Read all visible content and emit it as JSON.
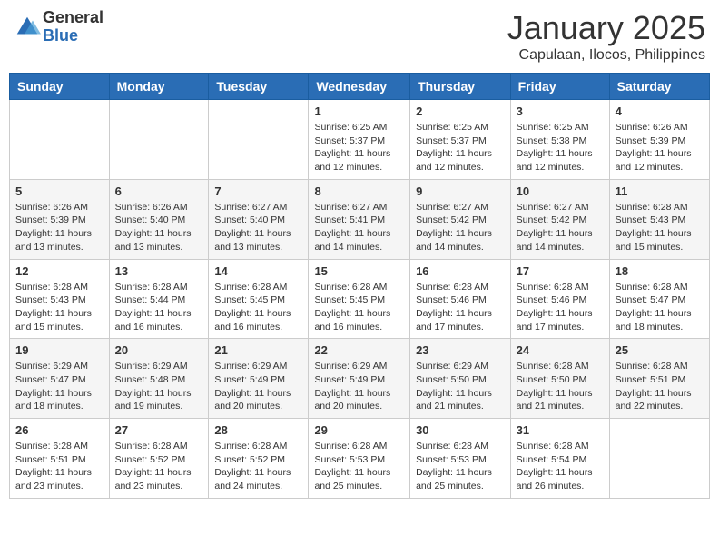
{
  "logo": {
    "general": "General",
    "blue": "Blue"
  },
  "header": {
    "month": "January 2025",
    "location": "Capulaan, Ilocos, Philippines"
  },
  "weekdays": [
    "Sunday",
    "Monday",
    "Tuesday",
    "Wednesday",
    "Thursday",
    "Friday",
    "Saturday"
  ],
  "weeks": [
    [
      {
        "day": "",
        "sunrise": "",
        "sunset": "",
        "daylight": ""
      },
      {
        "day": "",
        "sunrise": "",
        "sunset": "",
        "daylight": ""
      },
      {
        "day": "",
        "sunrise": "",
        "sunset": "",
        "daylight": ""
      },
      {
        "day": "1",
        "sunrise": "Sunrise: 6:25 AM",
        "sunset": "Sunset: 5:37 PM",
        "daylight": "Daylight: 11 hours and 12 minutes."
      },
      {
        "day": "2",
        "sunrise": "Sunrise: 6:25 AM",
        "sunset": "Sunset: 5:37 PM",
        "daylight": "Daylight: 11 hours and 12 minutes."
      },
      {
        "day": "3",
        "sunrise": "Sunrise: 6:25 AM",
        "sunset": "Sunset: 5:38 PM",
        "daylight": "Daylight: 11 hours and 12 minutes."
      },
      {
        "day": "4",
        "sunrise": "Sunrise: 6:26 AM",
        "sunset": "Sunset: 5:39 PM",
        "daylight": "Daylight: 11 hours and 12 minutes."
      }
    ],
    [
      {
        "day": "5",
        "sunrise": "Sunrise: 6:26 AM",
        "sunset": "Sunset: 5:39 PM",
        "daylight": "Daylight: 11 hours and 13 minutes."
      },
      {
        "day": "6",
        "sunrise": "Sunrise: 6:26 AM",
        "sunset": "Sunset: 5:40 PM",
        "daylight": "Daylight: 11 hours and 13 minutes."
      },
      {
        "day": "7",
        "sunrise": "Sunrise: 6:27 AM",
        "sunset": "Sunset: 5:40 PM",
        "daylight": "Daylight: 11 hours and 13 minutes."
      },
      {
        "day": "8",
        "sunrise": "Sunrise: 6:27 AM",
        "sunset": "Sunset: 5:41 PM",
        "daylight": "Daylight: 11 hours and 14 minutes."
      },
      {
        "day": "9",
        "sunrise": "Sunrise: 6:27 AM",
        "sunset": "Sunset: 5:42 PM",
        "daylight": "Daylight: 11 hours and 14 minutes."
      },
      {
        "day": "10",
        "sunrise": "Sunrise: 6:27 AM",
        "sunset": "Sunset: 5:42 PM",
        "daylight": "Daylight: 11 hours and 14 minutes."
      },
      {
        "day": "11",
        "sunrise": "Sunrise: 6:28 AM",
        "sunset": "Sunset: 5:43 PM",
        "daylight": "Daylight: 11 hours and 15 minutes."
      }
    ],
    [
      {
        "day": "12",
        "sunrise": "Sunrise: 6:28 AM",
        "sunset": "Sunset: 5:43 PM",
        "daylight": "Daylight: 11 hours and 15 minutes."
      },
      {
        "day": "13",
        "sunrise": "Sunrise: 6:28 AM",
        "sunset": "Sunset: 5:44 PM",
        "daylight": "Daylight: 11 hours and 16 minutes."
      },
      {
        "day": "14",
        "sunrise": "Sunrise: 6:28 AM",
        "sunset": "Sunset: 5:45 PM",
        "daylight": "Daylight: 11 hours and 16 minutes."
      },
      {
        "day": "15",
        "sunrise": "Sunrise: 6:28 AM",
        "sunset": "Sunset: 5:45 PM",
        "daylight": "Daylight: 11 hours and 16 minutes."
      },
      {
        "day": "16",
        "sunrise": "Sunrise: 6:28 AM",
        "sunset": "Sunset: 5:46 PM",
        "daylight": "Daylight: 11 hours and 17 minutes."
      },
      {
        "day": "17",
        "sunrise": "Sunrise: 6:28 AM",
        "sunset": "Sunset: 5:46 PM",
        "daylight": "Daylight: 11 hours and 17 minutes."
      },
      {
        "day": "18",
        "sunrise": "Sunrise: 6:28 AM",
        "sunset": "Sunset: 5:47 PM",
        "daylight": "Daylight: 11 hours and 18 minutes."
      }
    ],
    [
      {
        "day": "19",
        "sunrise": "Sunrise: 6:29 AM",
        "sunset": "Sunset: 5:47 PM",
        "daylight": "Daylight: 11 hours and 18 minutes."
      },
      {
        "day": "20",
        "sunrise": "Sunrise: 6:29 AM",
        "sunset": "Sunset: 5:48 PM",
        "daylight": "Daylight: 11 hours and 19 minutes."
      },
      {
        "day": "21",
        "sunrise": "Sunrise: 6:29 AM",
        "sunset": "Sunset: 5:49 PM",
        "daylight": "Daylight: 11 hours and 20 minutes."
      },
      {
        "day": "22",
        "sunrise": "Sunrise: 6:29 AM",
        "sunset": "Sunset: 5:49 PM",
        "daylight": "Daylight: 11 hours and 20 minutes."
      },
      {
        "day": "23",
        "sunrise": "Sunrise: 6:29 AM",
        "sunset": "Sunset: 5:50 PM",
        "daylight": "Daylight: 11 hours and 21 minutes."
      },
      {
        "day": "24",
        "sunrise": "Sunrise: 6:28 AM",
        "sunset": "Sunset: 5:50 PM",
        "daylight": "Daylight: 11 hours and 21 minutes."
      },
      {
        "day": "25",
        "sunrise": "Sunrise: 6:28 AM",
        "sunset": "Sunset: 5:51 PM",
        "daylight": "Daylight: 11 hours and 22 minutes."
      }
    ],
    [
      {
        "day": "26",
        "sunrise": "Sunrise: 6:28 AM",
        "sunset": "Sunset: 5:51 PM",
        "daylight": "Daylight: 11 hours and 23 minutes."
      },
      {
        "day": "27",
        "sunrise": "Sunrise: 6:28 AM",
        "sunset": "Sunset: 5:52 PM",
        "daylight": "Daylight: 11 hours and 23 minutes."
      },
      {
        "day": "28",
        "sunrise": "Sunrise: 6:28 AM",
        "sunset": "Sunset: 5:52 PM",
        "daylight": "Daylight: 11 hours and 24 minutes."
      },
      {
        "day": "29",
        "sunrise": "Sunrise: 6:28 AM",
        "sunset": "Sunset: 5:53 PM",
        "daylight": "Daylight: 11 hours and 25 minutes."
      },
      {
        "day": "30",
        "sunrise": "Sunrise: 6:28 AM",
        "sunset": "Sunset: 5:53 PM",
        "daylight": "Daylight: 11 hours and 25 minutes."
      },
      {
        "day": "31",
        "sunrise": "Sunrise: 6:28 AM",
        "sunset": "Sunset: 5:54 PM",
        "daylight": "Daylight: 11 hours and 26 minutes."
      },
      {
        "day": "",
        "sunrise": "",
        "sunset": "",
        "daylight": ""
      }
    ]
  ]
}
